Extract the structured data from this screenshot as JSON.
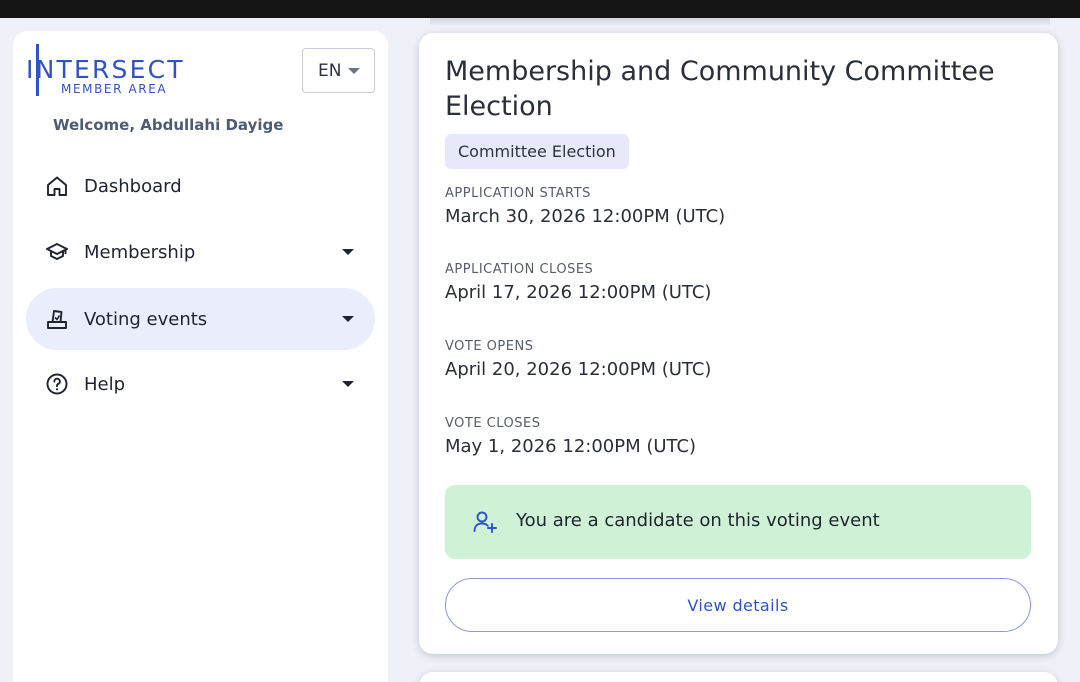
{
  "header": {
    "lang": "EN"
  },
  "logo": {
    "word": "INTERSECT",
    "sub": "MEMBER AREA"
  },
  "welcome": "Welcome, Abdullahi Dayige",
  "nav": [
    {
      "label": "Dashboard",
      "icon": "home-icon"
    },
    {
      "label": "Membership",
      "icon": "graduation-cap-icon"
    },
    {
      "label": "Voting events",
      "icon": "ballot-box-icon",
      "active": true
    },
    {
      "label": "Help",
      "icon": "help-circle-icon"
    }
  ],
  "event": {
    "title": "Membership and Community Committee Election",
    "type": "Committee Election",
    "fields": [
      {
        "label": "APPLICATION STARTS",
        "value": "March 30, 2026 12:00PM (UTC)"
      },
      {
        "label": "APPLICATION CLOSES",
        "value": "April 17, 2026 12:00PM (UTC)"
      },
      {
        "label": "VOTE OPENS",
        "value": "April 20, 2026 12:00PM (UTC)"
      },
      {
        "label": "VOTE CLOSES",
        "value": "May 1, 2026 12:00PM (UTC)"
      }
    ],
    "notice": "You are a candidate on this voting event",
    "button": "View details"
  },
  "colors": {
    "accent": "#3052c5",
    "notice_bg": "#cff1d6",
    "active_nav_bg": "#eaedfb",
    "chip_bg": "#e8e8fb"
  }
}
